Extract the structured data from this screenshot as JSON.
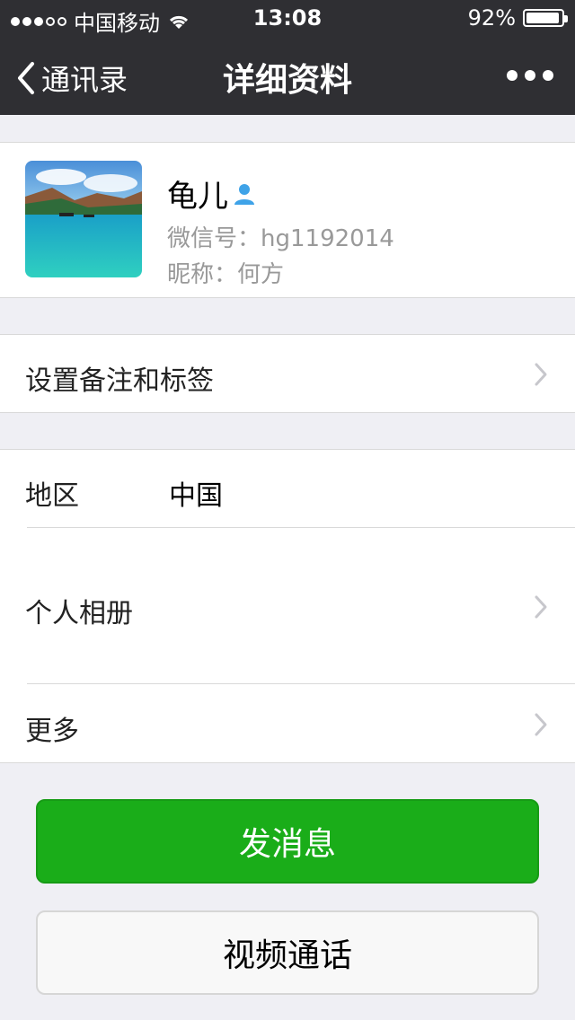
{
  "status_bar": {
    "carrier": "中国移动",
    "time": "13:08",
    "battery_text": "92%",
    "battery_level": 0.92,
    "signal_strength": 3,
    "signal_max": 5
  },
  "nav": {
    "back_label": "通讯录",
    "title": "详细资料"
  },
  "profile": {
    "name": "龟儿",
    "wechat_id": "微信号：hg1192014",
    "nickname": "昵称：何方"
  },
  "actions": {
    "remark_tags": "设置备注和标签"
  },
  "details": {
    "region_label": "地区",
    "region_value": "中国",
    "album_label": "个人相册",
    "more_label": "更多"
  },
  "buttons": {
    "send_message": "发消息",
    "video_call": "视频通话"
  },
  "colors": {
    "nav_bg": "#2f2f33",
    "primary_green": "#1aad19",
    "page_bg": "#efeff4"
  }
}
